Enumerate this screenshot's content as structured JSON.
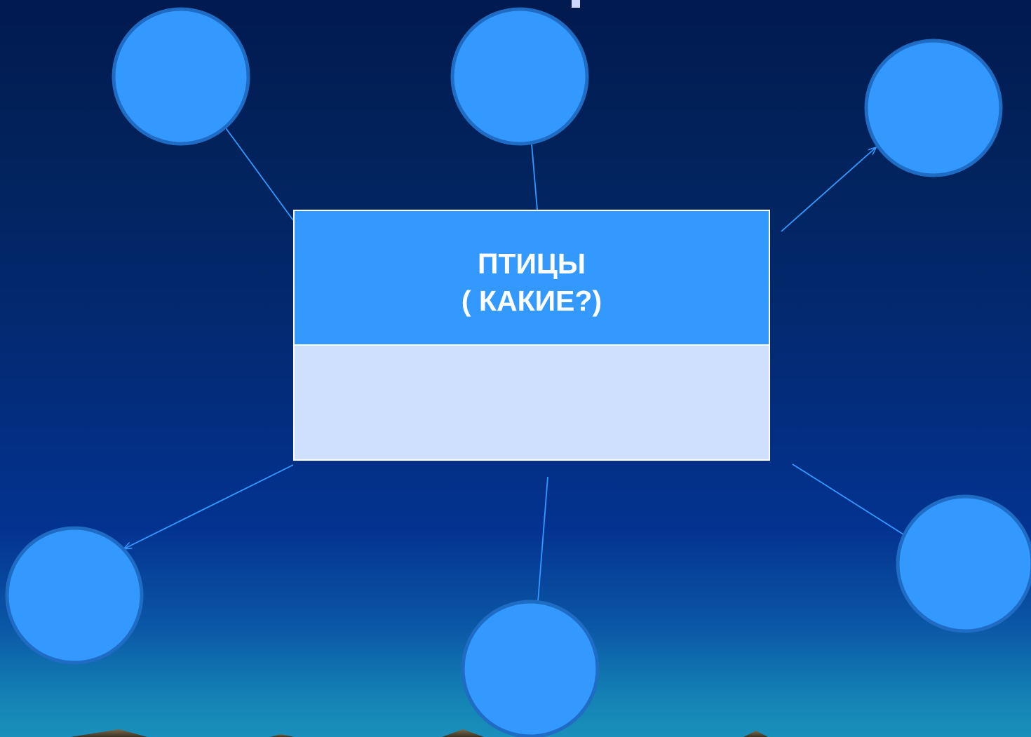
{
  "colors": {
    "node_fill": "#3399ff",
    "node_stroke": "#1f6cc4",
    "connector": "#3399ff",
    "box_top": "#3399ff",
    "box_bottom": "#cfe0ff",
    "box_border": "#ffffff",
    "text": "#ffffff"
  },
  "center_box": {
    "line1": "ПТИЦЫ",
    "line2": "( КАКИЕ?)"
  },
  "nodes": [
    {
      "id": "top-left",
      "label": ""
    },
    {
      "id": "top-center",
      "label": ""
    },
    {
      "id": "top-right",
      "label": ""
    },
    {
      "id": "bottom-left",
      "label": ""
    },
    {
      "id": "bottom-center",
      "label": ""
    },
    {
      "id": "bottom-right",
      "label": ""
    }
  ]
}
